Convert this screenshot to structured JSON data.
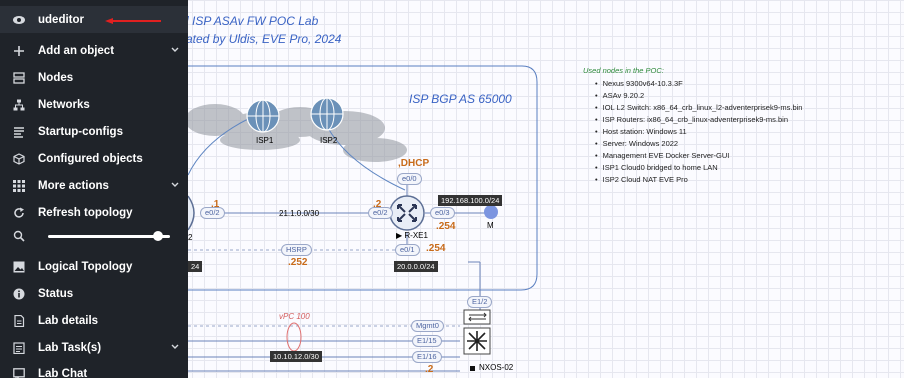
{
  "lab": {
    "title_line1": "l ISP ASAv FW POC Lab",
    "title_line2": "ated by Uldis, EVE Pro, 2024",
    "cloud_label": "ISP BGP AS 65000"
  },
  "sidebar": {
    "items": [
      {
        "label": "udeditor",
        "icon": "eye-icon"
      },
      {
        "label": "Add an object",
        "icon": "plus-icon",
        "has_chevron": true
      },
      {
        "label": "Nodes",
        "icon": "server-icon"
      },
      {
        "label": "Networks",
        "icon": "network-icon"
      },
      {
        "label": "Startup-configs",
        "icon": "config-list-icon"
      },
      {
        "label": "Configured objects",
        "icon": "cube-icon"
      },
      {
        "label": "More actions",
        "icon": "grid-icon",
        "has_chevron": true
      },
      {
        "label": "Refresh topology",
        "icon": "refresh-icon"
      },
      {
        "label": "Logical Topology",
        "icon": "image-icon"
      },
      {
        "label": "Status",
        "icon": "info-icon"
      },
      {
        "label": "Lab details",
        "icon": "document-icon"
      },
      {
        "label": "Lab Task(s)",
        "icon": "task-icon",
        "has_chevron": true
      },
      {
        "label": "Lab Chat",
        "icon": "chat-icon"
      }
    ],
    "zoom_level": 0.9
  },
  "notes": {
    "title": "Used nodes in the POC:",
    "items": [
      "Nexus 9300v64-10.3.3F",
      "ASAv 9.20.2",
      "IOL L2 Switch: x86_64_crb_linux_l2-adventerprisek9-ms.bin",
      "ISP Routers: ix86_64_crb_linux-adventerprisek9-ms.bin",
      "Host station: Windows 11",
      "Server: Windows 2022",
      "Management EVE Docker Server-GUI",
      "ISP1 Cloud0 bridged to home LAN",
      "ISP2 Cloud NAT EVE Pro"
    ]
  },
  "topology": {
    "isp1": "ISP1",
    "isp2": "ISP2",
    "dhcp": ",DHCP",
    "e0_0": "e0/0",
    "e0_1": "e0/1",
    "e0_2": "e0/2",
    "e0_2_left": "e0/2",
    "e0_3": "e0/3",
    "ip_left_1": ".1",
    "ip_left_2": ".2",
    "ip_r_e02": ".2",
    "subnet_21": "21.1.0.0/30",
    "subnet_192": "192.168.100.0/24",
    "ip_254_a": ".254",
    "ip_254_b": ".254",
    "ip_252": ".252",
    "hsrp": "HSRP",
    "subnet_20": "20.0.0.0/24",
    "left_24": "24",
    "left_2": "2",
    "r_xe1": "R-XE1",
    "m_label": "M",
    "vpc": "vPC 100",
    "mgmt0": "Mgmt0",
    "e1_2": "E1/2",
    "e1_15": "E1/15",
    "e1_16": "E1/16",
    "subnet_10": "10.10.12.0/30",
    "ip_nxos": ".2",
    "nxos": "NXOS-02"
  }
}
